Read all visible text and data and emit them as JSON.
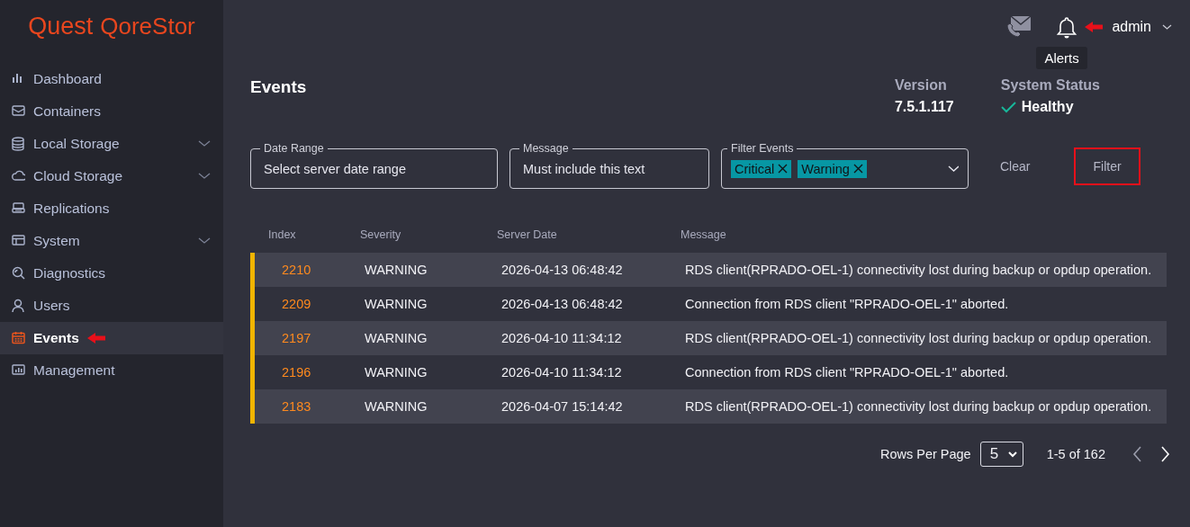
{
  "logo": {
    "brand": "Quest",
    "product": "QoreStor"
  },
  "sidebar": {
    "items": [
      {
        "label": "Dashboard",
        "expandable": false,
        "selected": false
      },
      {
        "label": "Containers",
        "expandable": false,
        "selected": false
      },
      {
        "label": "Local Storage",
        "expandable": true,
        "selected": false
      },
      {
        "label": "Cloud Storage",
        "expandable": true,
        "selected": false
      },
      {
        "label": "Replications",
        "expandable": false,
        "selected": false
      },
      {
        "label": "System",
        "expandable": true,
        "selected": false
      },
      {
        "label": "Diagnostics",
        "expandable": false,
        "selected": false
      },
      {
        "label": "Users",
        "expandable": false,
        "selected": false
      },
      {
        "label": "Events",
        "expandable": false,
        "selected": true
      },
      {
        "label": "Management",
        "expandable": false,
        "selected": false
      }
    ]
  },
  "header": {
    "user": "admin",
    "tooltip": "Alerts"
  },
  "page": {
    "title": "Events",
    "version_label": "Version",
    "version": "7.5.1.117",
    "status_label": "System Status",
    "status": "Healthy"
  },
  "filters": {
    "date_range": {
      "label": "Date Range",
      "placeholder": "Select server date range"
    },
    "message": {
      "label": "Message",
      "placeholder": "Must include this text"
    },
    "filter_events": {
      "label": "Filter Events",
      "chips": [
        "Critical",
        "Warning"
      ]
    },
    "clear": "Clear",
    "filter": "Filter"
  },
  "table": {
    "columns": [
      "Index",
      "Severity",
      "Server Date",
      "Message"
    ],
    "rows": [
      {
        "index": "2210",
        "severity": "WARNING",
        "date": "2026-04-13 06:48:42",
        "message": "RDS client(RPRADO-OEL-1) connectivity lost during backup or opdup operation.",
        "color": "#f0b400"
      },
      {
        "index": "2209",
        "severity": "WARNING",
        "date": "2026-04-13 06:48:42",
        "message": "Connection from RDS client \"RPRADO-OEL-1\" aborted.",
        "color": "#f0b400"
      },
      {
        "index": "2197",
        "severity": "WARNING",
        "date": "2026-04-10 11:34:12",
        "message": "RDS client(RPRADO-OEL-1) connectivity lost during backup or opdup operation.",
        "color": "#f0b400"
      },
      {
        "index": "2196",
        "severity": "WARNING",
        "date": "2026-04-10 11:34:12",
        "message": "Connection from RDS client \"RPRADO-OEL-1\" aborted.",
        "color": "#f0b400"
      },
      {
        "index": "2183",
        "severity": "WARNING",
        "date": "2026-04-07 15:14:42",
        "message": "RDS client(RPRADO-OEL-1) connectivity lost during backup or opdup operation.",
        "color": "#f0b400"
      }
    ]
  },
  "pagination": {
    "label": "Rows Per Page",
    "rows_per_page": "5",
    "range": "1-5 of 162"
  }
}
